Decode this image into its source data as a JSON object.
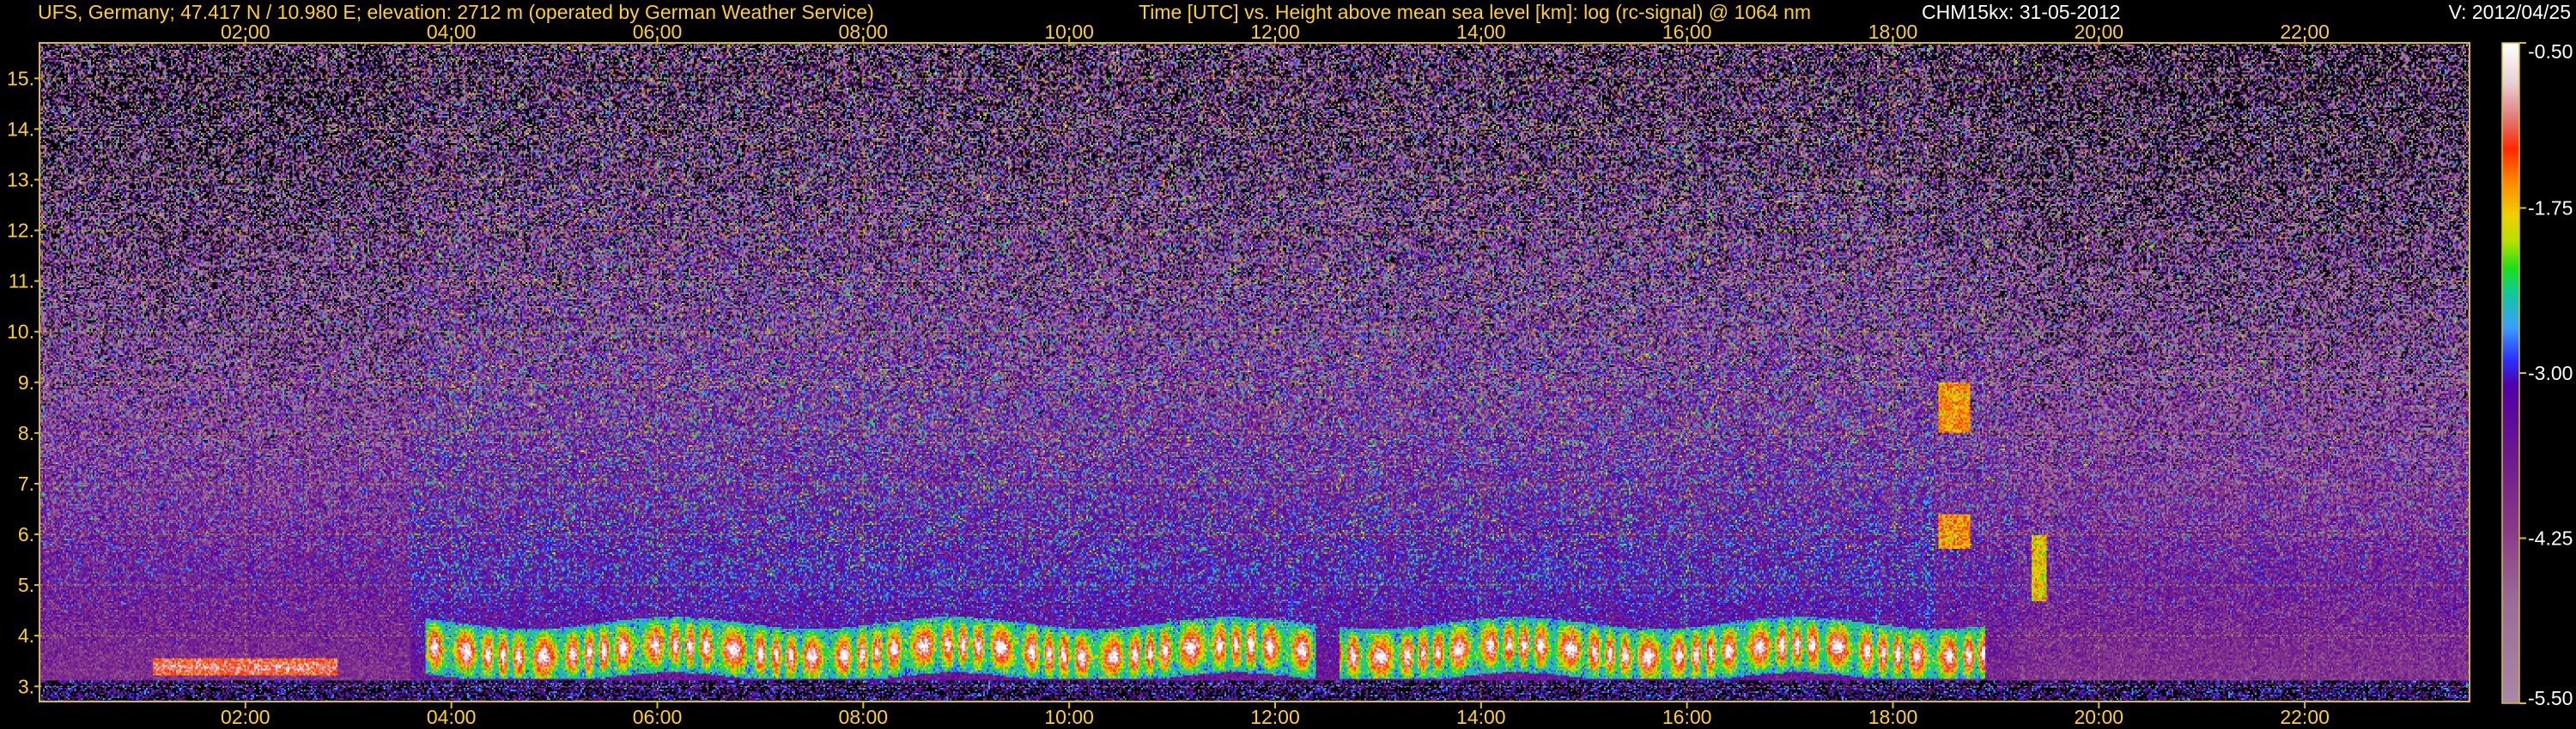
{
  "header": {
    "station": "UFS, Germany; 47.417 N / 10.980 E; elevation: 2712 m  (operated by German Weather Service)",
    "axes_desc": "Time [UTC] vs. Height above mean sea level [km]: log (rc-signal) @ 1064 nm",
    "instrument_date": "CHM15kx: 31-05-2012",
    "version": "V: 2012/04/25"
  },
  "colors": {
    "text": "#ffd21f",
    "frame": "#d8c020",
    "grid": "#b8a818",
    "background": "#000000",
    "white_text": "#ffffff"
  },
  "chart_data": {
    "type": "heatmap",
    "x_label": "Time [UTC]",
    "y_label": "Height above mean sea level [km]",
    "variable": "log (rc-signal) @ 1064 nm",
    "x_range_hours": [
      0.0,
      23.6
    ],
    "y_range_km": [
      2.7,
      15.7
    ],
    "x_ticks": [
      "02:00",
      "04:00",
      "06:00",
      "08:00",
      "10:00",
      "12:00",
      "14:00",
      "16:00",
      "18:00",
      "20:00",
      "22:00"
    ],
    "x_tick_hours": [
      2,
      4,
      6,
      8,
      10,
      12,
      14,
      16,
      18,
      20,
      22
    ],
    "y_ticks": [
      "3.",
      "4.",
      "5.",
      "6.",
      "7.",
      "8.",
      "9.",
      "10.",
      "11.",
      "12.",
      "13.",
      "14.",
      "15."
    ],
    "y_tick_km": [
      3,
      4,
      5,
      6,
      7,
      8,
      9,
      10,
      11,
      12,
      13,
      14,
      15
    ],
    "grid": true,
    "colorbar": {
      "min": -5.5,
      "max": -0.5,
      "tick_values": [
        -0.5,
        -1.75,
        -3.0,
        -4.25,
        -5.5
      ],
      "tick_labels": [
        "-0.50",
        "-1.75",
        "-3.00",
        "-4.25",
        "-5.50"
      ],
      "stops": [
        [
          -5.5,
          "#a888a8"
        ],
        [
          -4.7,
          "#9a6a98"
        ],
        [
          -4.2,
          "#8a3a8a"
        ],
        [
          -3.6,
          "#6a1890"
        ],
        [
          -3.1,
          "#5000a8"
        ],
        [
          -2.9,
          "#2a30ff"
        ],
        [
          -2.65,
          "#3aa0ff"
        ],
        [
          -2.4,
          "#10c8a0"
        ],
        [
          -2.2,
          "#1ce018"
        ],
        [
          -2.0,
          "#b8e000"
        ],
        [
          -1.8,
          "#f0d000"
        ],
        [
          -1.55,
          "#ff8800"
        ],
        [
          -1.3,
          "#ff2800"
        ],
        [
          -1.05,
          "#e08080"
        ],
        [
          -0.8,
          "#e8d0d8"
        ],
        [
          -0.5,
          "#ffffff"
        ]
      ]
    }
  }
}
